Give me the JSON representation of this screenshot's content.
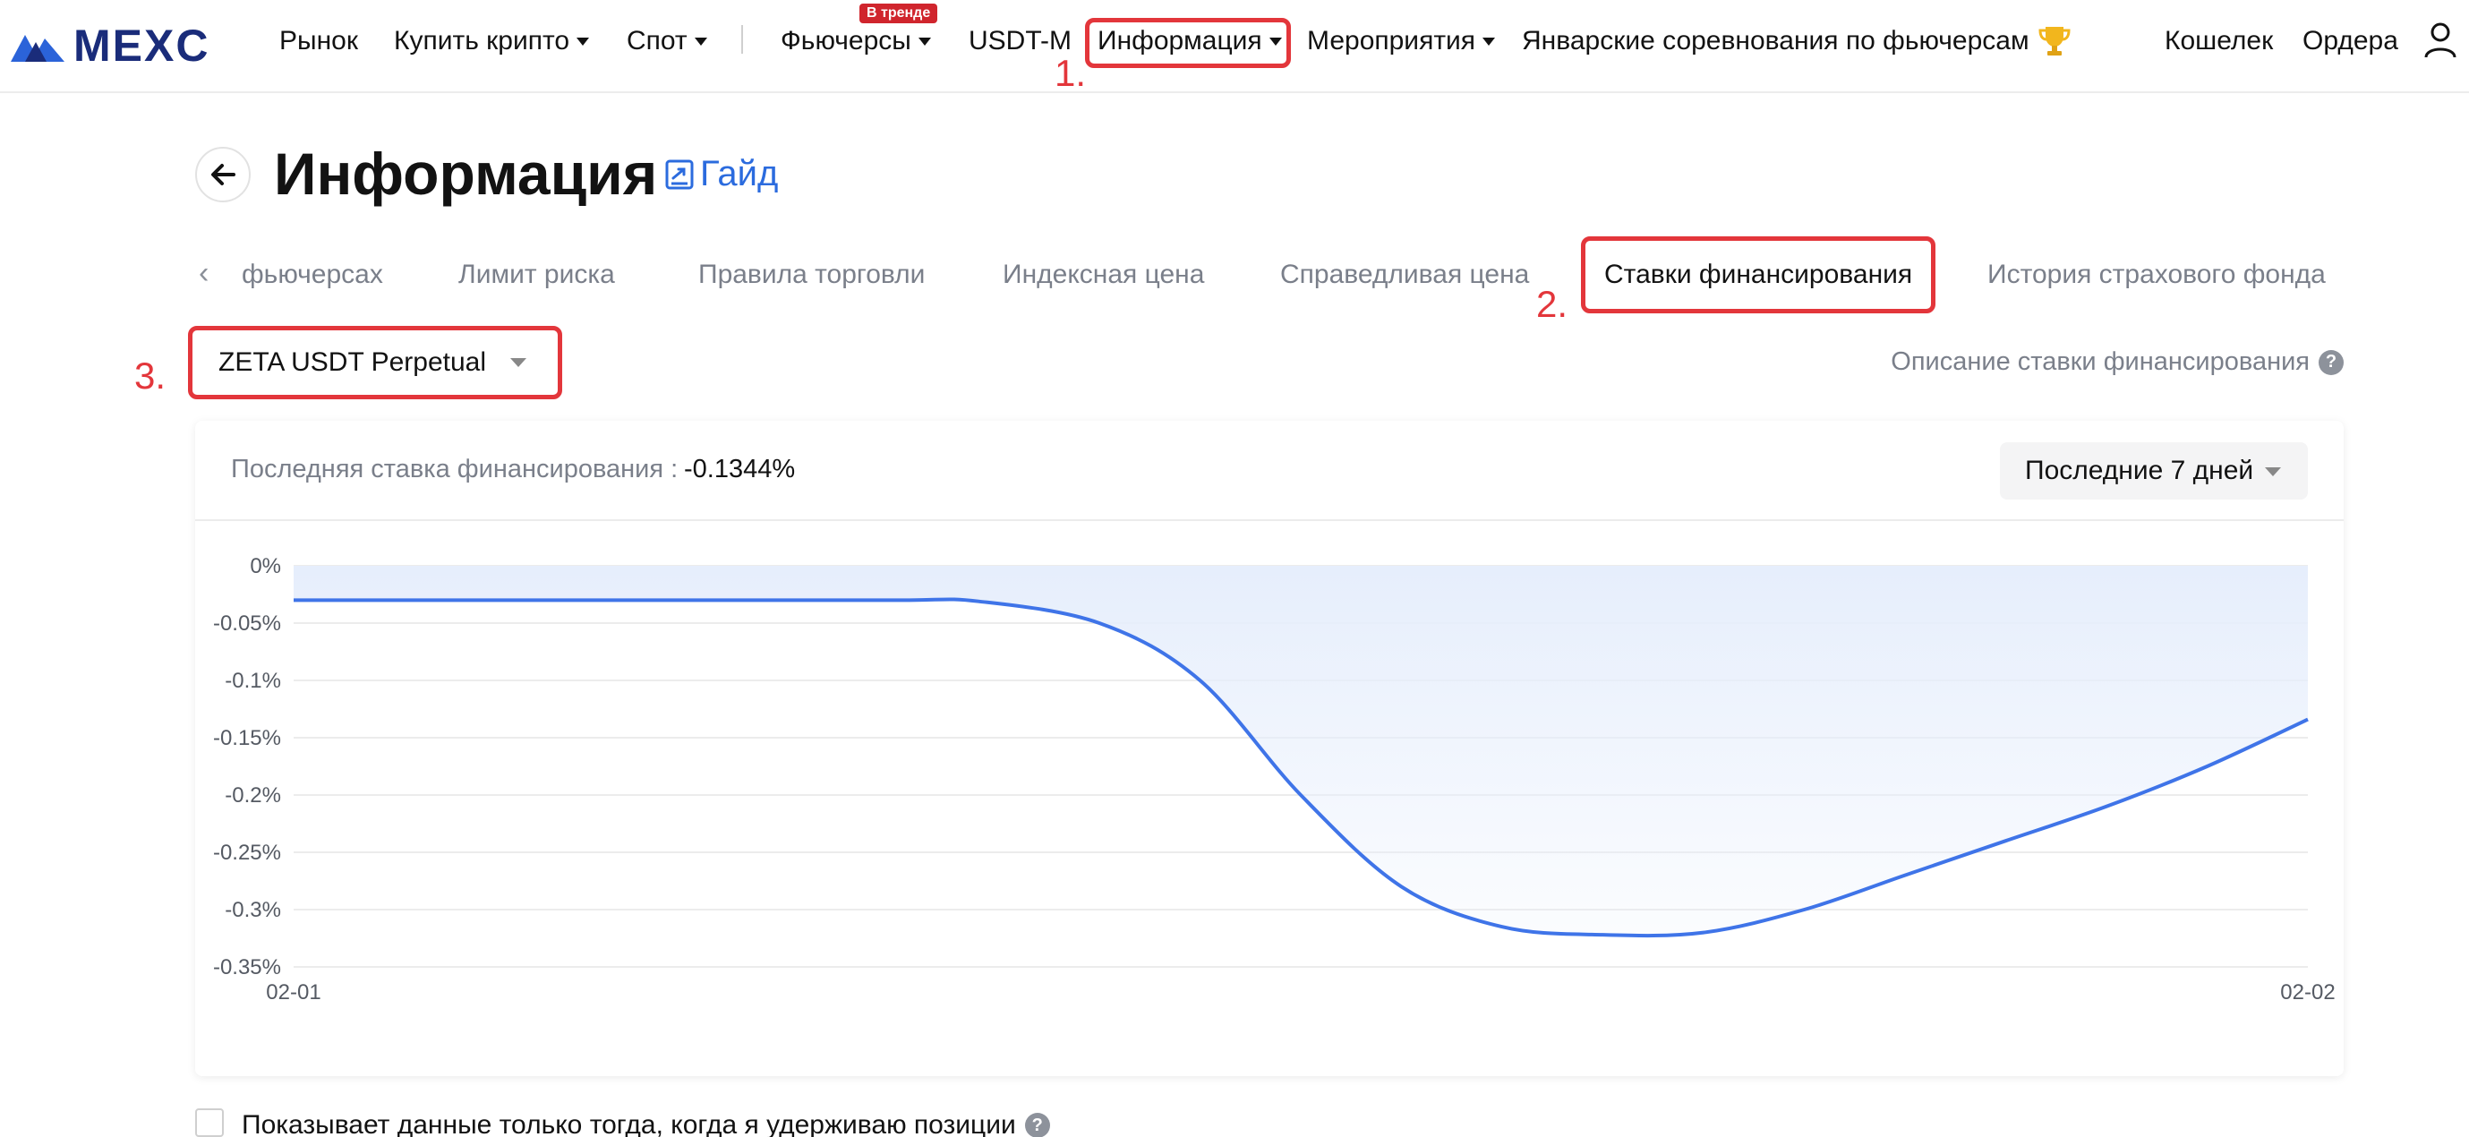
{
  "nav": {
    "logo_text": "MEXC",
    "items": [
      {
        "label": "Рынок"
      },
      {
        "label": "Купить крипто"
      },
      {
        "label": "Спот"
      },
      {
        "label": "Фьючерсы"
      },
      {
        "label": "USDT-M"
      },
      {
        "label": "Информация"
      },
      {
        "label": "Мероприятия"
      },
      {
        "label": "Январские соревнования по фьючерсам"
      },
      {
        "label": "Кошелек"
      },
      {
        "label": "Ордера"
      }
    ],
    "trend_badge": "В тренде"
  },
  "annotations": {
    "step1": "1.",
    "step2": "2.",
    "step3": "3."
  },
  "page": {
    "title": "Информация",
    "guide_label": "Гайд"
  },
  "tabs": [
    {
      "label": "фьючерсах"
    },
    {
      "label": "Лимит риска"
    },
    {
      "label": "Правила торговли"
    },
    {
      "label": "Индексная цена"
    },
    {
      "label": "Справедливая цена"
    },
    {
      "label": "Ставки финансирования",
      "active": true
    },
    {
      "label": "История страхового фонда"
    }
  ],
  "symbol_select": {
    "value": "ZETA USDT Perpetual"
  },
  "funding_description_link": "Описание ставки финансирования",
  "card": {
    "last_rate_label": "Последняя ставка финансирования :",
    "last_rate_value": "-0.1344%",
    "period_value": "Последние 7 дней"
  },
  "chart_data": {
    "type": "area",
    "x_ticks": [
      "02-01",
      "02-02"
    ],
    "y_ticks": [
      "0%",
      "-0.05%",
      "-0.1%",
      "-0.15%",
      "-0.2%",
      "-0.25%",
      "-0.3%",
      "-0.35%"
    ],
    "ylim": [
      -0.35,
      0
    ],
    "series": [
      {
        "x": [
          0,
          0.1,
          0.2,
          0.3,
          0.34,
          0.4,
          0.45,
          0.5,
          0.55,
          0.6,
          0.65,
          0.7,
          0.75,
          0.8,
          0.85,
          0.9,
          0.95,
          1.0
        ],
        "values": [
          -0.03,
          -0.03,
          -0.03,
          -0.03,
          -0.031,
          -0.05,
          -0.1,
          -0.2,
          -0.28,
          -0.315,
          -0.322,
          -0.32,
          -0.3,
          -0.27,
          -0.24,
          -0.21,
          -0.175,
          -0.134
        ]
      }
    ],
    "line_color": "#3f74e8",
    "fill_color": "#e6eefc",
    "grid": true
  },
  "footer": {
    "only_positions_label": "Показывает данные только тогда, когда я удерживаю позиции"
  }
}
